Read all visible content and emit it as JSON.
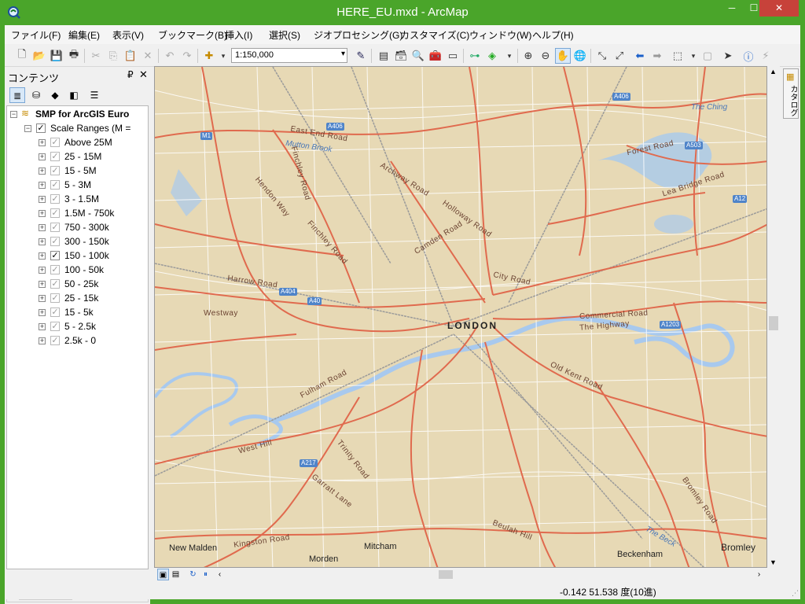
{
  "window": {
    "title": "HERE_EU.mxd - ArcMap",
    "min": "─",
    "max": "☐",
    "close": "✕"
  },
  "menu": [
    "ファイル(F)",
    "編集(E)",
    "表示(V)",
    "ブックマーク(B)",
    "挿入(I)",
    "選択(S)",
    "ジオプロセシング(G)",
    "カスタマイズ(C)",
    "ウィンドウ(W)",
    "ヘルプ(H)"
  ],
  "toolbar": {
    "scale": "1:150,000",
    "scale_dropdown": "▾"
  },
  "toc": {
    "title": "コンテンツ",
    "pin": "₽",
    "close": "✕",
    "root": "SMP for ArcGIS Euro",
    "group": "Scale Ranges (M =",
    "layers": [
      {
        "label": "Above 25M",
        "checked": false
      },
      {
        "label": "25 - 15M",
        "checked": false
      },
      {
        "label": "15 - 5M",
        "checked": false
      },
      {
        "label": "5 - 3M",
        "checked": false
      },
      {
        "label": "3 - 1.5M",
        "checked": false
      },
      {
        "label": "1.5M - 750k",
        "checked": false
      },
      {
        "label": "750 - 300k",
        "checked": false
      },
      {
        "label": "300 - 150k",
        "checked": false
      },
      {
        "label": "150 - 100k",
        "checked": true
      },
      {
        "label": "100 - 50k",
        "checked": false
      },
      {
        "label": "50 - 25k",
        "checked": false
      },
      {
        "label": "25 - 15k",
        "checked": false
      },
      {
        "label": "15 - 5k",
        "checked": false
      },
      {
        "label": "5 - 2.5k",
        "checked": false
      },
      {
        "label": "2.5k - 0",
        "checked": false
      }
    ]
  },
  "catalog_tab": "カタログ",
  "map": {
    "city": "LONDON",
    "roads": [
      "East End Road",
      "Mutton Brook",
      "Finchley Road",
      "Hendon Way",
      "Archway Road",
      "Holloway Road",
      "Camden Road",
      "Finchley Road",
      "Harrow Road",
      "Westway",
      "City Road",
      "Commercial Road",
      "The Highway",
      "Old Kent Road",
      "Fulham Road",
      "West Hill",
      "Trinity Road",
      "Garratt Lane",
      "Kingston Road",
      "Beulah Hill",
      "Forest Road",
      "Lea Bridge Road",
      "Bromley Road",
      "The Ching",
      "The Beck"
    ],
    "places": [
      "New Malden",
      "Morden",
      "Mitcham",
      "Beckenham",
      "Bromley"
    ],
    "shields": [
      "A406",
      "A406",
      "M1",
      "A503",
      "A12",
      "A404",
      "A40",
      "A1203",
      "A217"
    ]
  },
  "status": {
    "coords": "-0.142  51.538 度(10進)"
  },
  "colors": {
    "titlebar": "#4aa52a",
    "map_bg": "#e7d9b5",
    "road_major": "#e06a4e",
    "road_minor": "#ffffff",
    "water": "#a8c9ee",
    "rail": "#9a9a9a"
  }
}
